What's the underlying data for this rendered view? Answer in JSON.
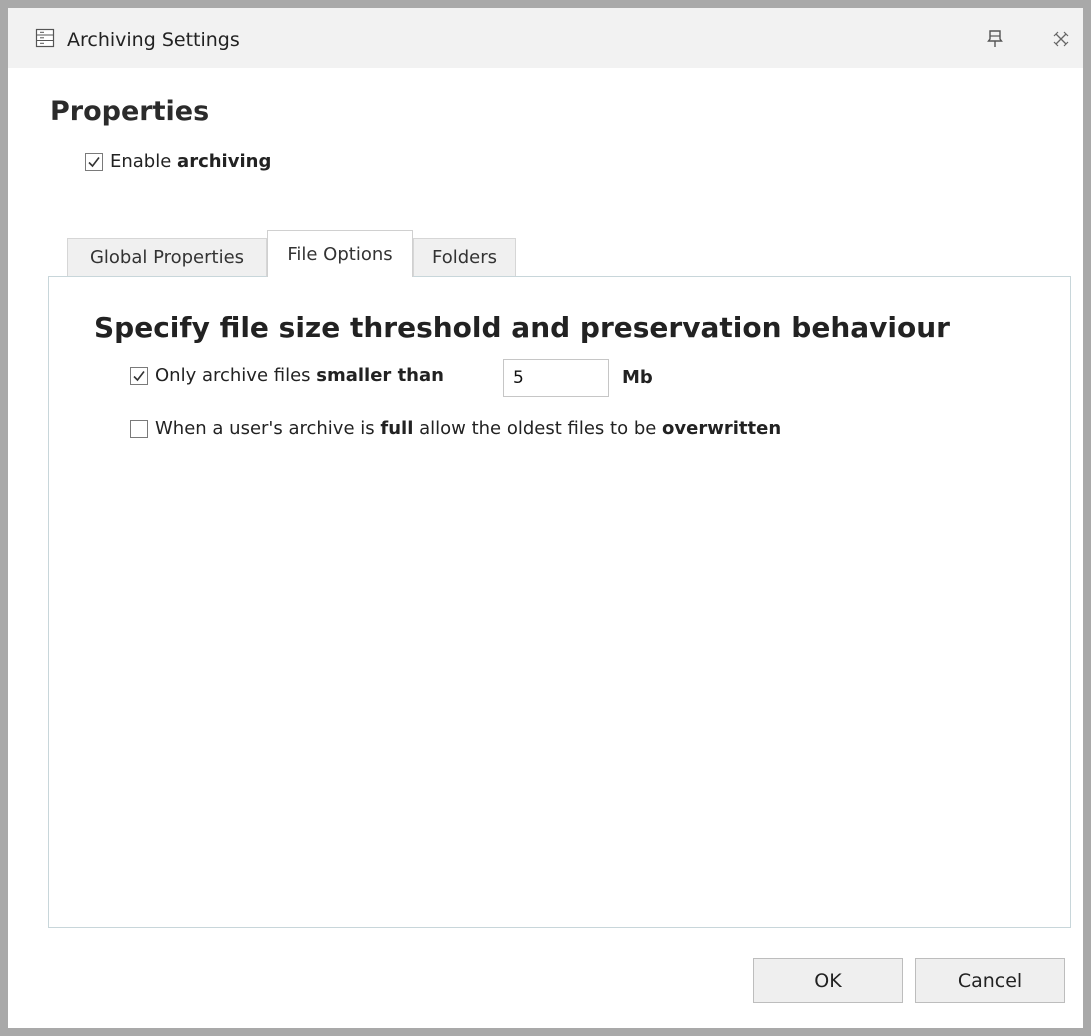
{
  "window": {
    "title": "Archiving Settings",
    "icons": {
      "title": "settings-list-icon",
      "pin": "pin-icon",
      "close": "close-icon"
    }
  },
  "properties": {
    "heading": "Properties",
    "enable": {
      "checked": true,
      "text": "Enable ",
      "bold": "archiving"
    }
  },
  "tabs": [
    {
      "label": "Global Properties",
      "active": false
    },
    {
      "label": "File Options",
      "active": true
    },
    {
      "label": "Folders",
      "active": false
    }
  ],
  "file_options": {
    "title": "Specify file size threshold and preservation behaviour",
    "size_limit": {
      "checked": true,
      "text": "Only archive files ",
      "bold": "smaller than",
      "value": "5",
      "unit": "Mb"
    },
    "overwrite": {
      "checked": false,
      "text1": "When a user's archive is ",
      "bold1": "full",
      "text2": " allow the oldest files to be ",
      "bold2": "overwritten"
    }
  },
  "buttons": {
    "ok": "OK",
    "cancel": "Cancel"
  }
}
